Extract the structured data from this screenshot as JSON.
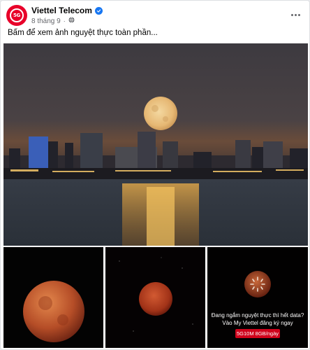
{
  "post": {
    "page_name": "Viettel Telecom",
    "avatar_label": "5G",
    "date": "8 tháng 9",
    "separator": "·",
    "caption": "Bấm để xem ảnh nguyệt thực toàn phần..."
  },
  "photos": {
    "ad_line1": "Đang ngắm nguyệt thực thì hết data?",
    "ad_line2": "Vào My Viettel đăng ký ngay",
    "ad_badge": "5G10M 8GB/ngày"
  },
  "colors": {
    "brand_red": "#e8002a",
    "verified_blue": "#1877f2",
    "meta_gray": "#65676b"
  },
  "icons": [
    "verified-icon",
    "globe-icon",
    "more-options-icon"
  ]
}
